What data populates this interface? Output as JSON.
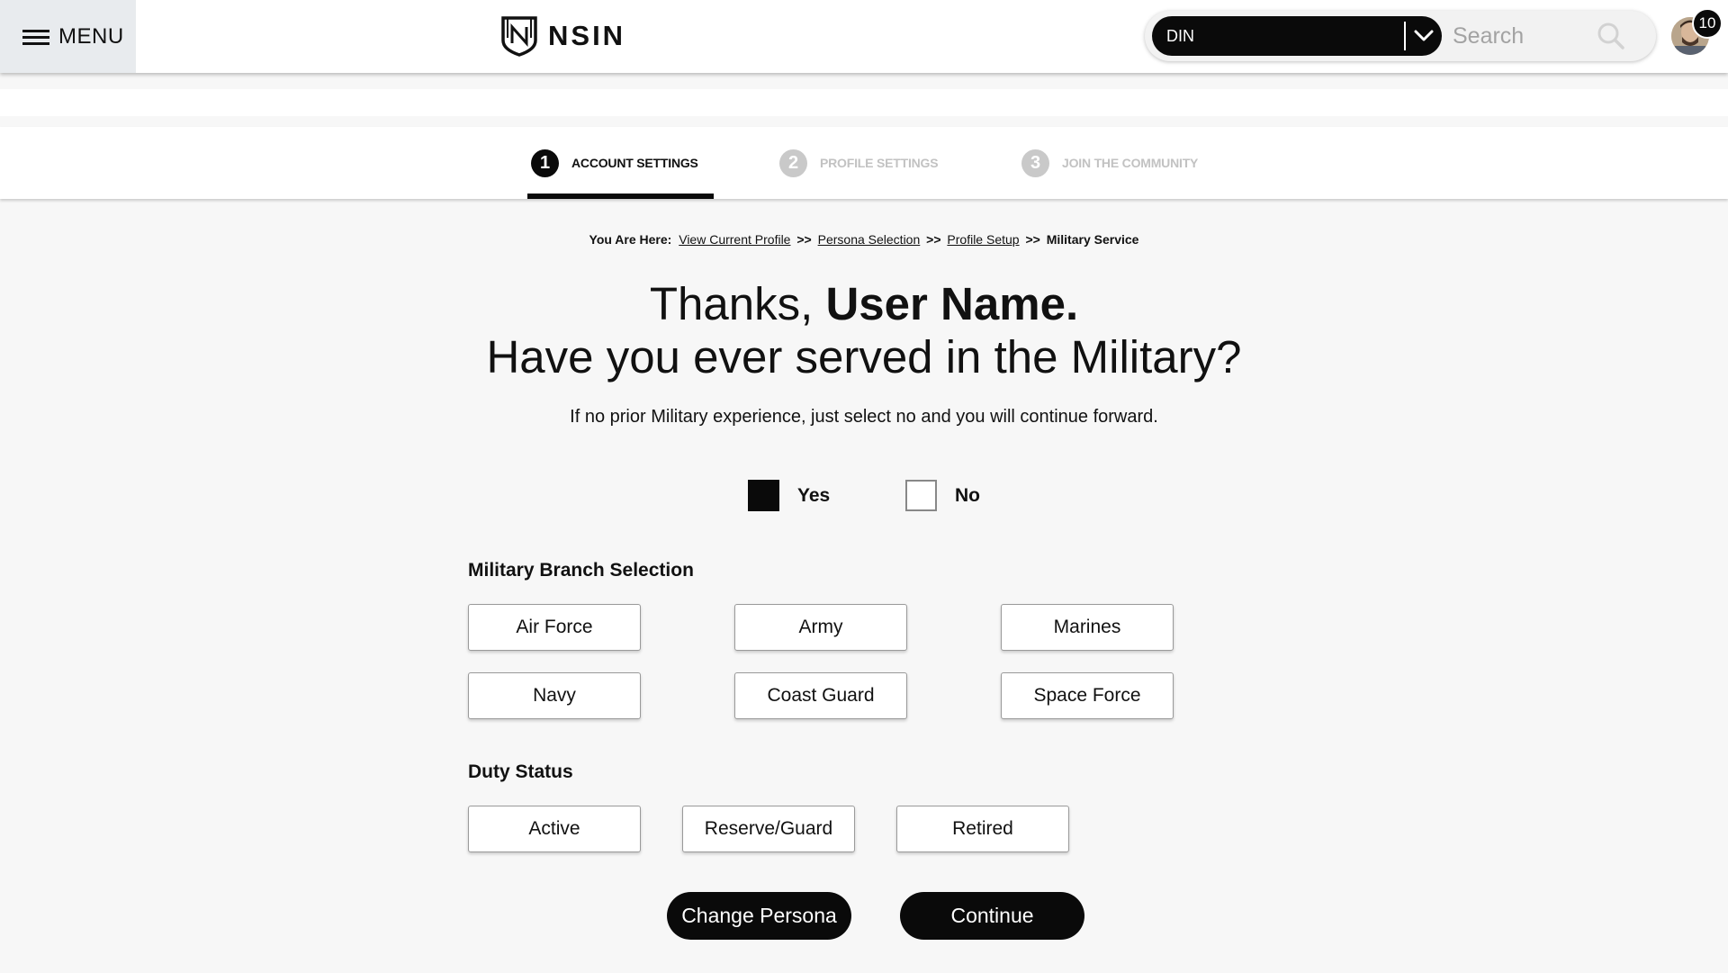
{
  "header": {
    "menu_label": "MENU",
    "logo_text": "NSIN",
    "din_select": {
      "value": "DIN"
    },
    "search": {
      "placeholder": "Search"
    },
    "notification_count": "10"
  },
  "stepper": {
    "steps": [
      {
        "number": "1",
        "label": "ACCOUNT SETTINGS",
        "state": "active"
      },
      {
        "number": "2",
        "label": "PROFILE SETTINGS",
        "state": "inactive"
      },
      {
        "number": "3",
        "label": "JOIN THE COMMUNITY",
        "state": "inactive"
      }
    ]
  },
  "breadcrumb": {
    "lead": "You Are Here:",
    "links": [
      "View Current Profile",
      "Persona Selection",
      "Profile Setup"
    ],
    "separator": ">>",
    "current": "Military Service"
  },
  "headline": {
    "line1_prefix": "Thanks,",
    "line1_name": "User Name.",
    "line2": "Have you ever served in the Military?"
  },
  "subtext": "If no prior Military experience, just select no and you will continue forward.",
  "military_experience": {
    "yes_label": "Yes",
    "no_label": "No",
    "selected": "Yes"
  },
  "branch": {
    "title": "Military Branch Selection",
    "options": [
      "Air Force",
      "Army",
      "Marines",
      "Navy",
      "Coast Guard",
      "Space Force"
    ]
  },
  "duty": {
    "title": "Duty Status",
    "options": [
      "Active",
      "Reserve/Guard",
      "Retired"
    ]
  },
  "actions": {
    "change_persona": "Change Persona",
    "continue": "Continue"
  },
  "colors": {
    "primary": "#0a0a0a",
    "page_background": "#f7f7f7",
    "menu_background": "#e8ebee",
    "inactive_step": "#c2c2c2"
  }
}
